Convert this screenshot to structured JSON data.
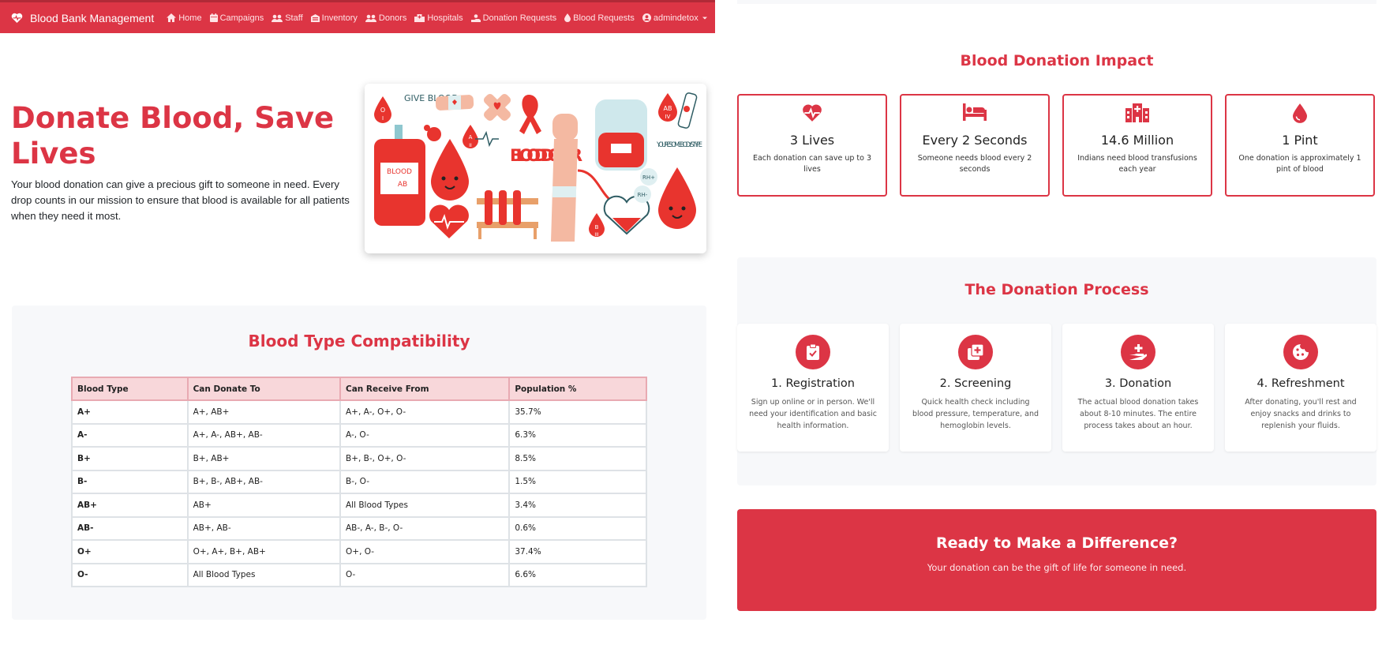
{
  "brand": {
    "name": "Blood Bank Management",
    "icon": "heart-pulse-icon"
  },
  "nav": {
    "items": [
      {
        "label": "Home",
        "icon": "home-icon"
      },
      {
        "label": "Campaigns",
        "icon": "calendar-icon"
      },
      {
        "label": "Staff",
        "icon": "users-icon"
      },
      {
        "label": "Inventory",
        "icon": "warehouse-icon"
      },
      {
        "label": "Donors",
        "icon": "users-icon"
      },
      {
        "label": "Hospitals",
        "icon": "hospital-icon"
      },
      {
        "label": "Donation Requests",
        "icon": "hand-icon"
      },
      {
        "label": "Blood Requests",
        "icon": "droplet-icon"
      }
    ],
    "user": {
      "label": "admindetox",
      "icon": "user-circle-icon"
    }
  },
  "hero": {
    "title": "Donate Blood, Save Lives",
    "text": "Your blood donation can give a precious gift to someone in need. Every drop counts in our mission to ensure that blood is available for all patients when they need it most.",
    "image_texts": {
      "give_blood": "GIVE BLOOD",
      "blood_donor": "BLOOD DONOR",
      "bag_label_1": "BLOOD",
      "bag_label_2": "AB",
      "somebody": "YOU'RE SOMEBODY'S TYPE",
      "o": "O",
      "o_num": "I",
      "a": "A",
      "a_num": "II",
      "ab": "AB",
      "ab_num": "IV",
      "b": "B",
      "b_num": "III",
      "rh_plus": "RH+",
      "rh_minus": "RH-"
    }
  },
  "compatibility": {
    "title": "Blood Type Compatibility",
    "headers": [
      "Blood Type",
      "Can Donate To",
      "Can Receive From",
      "Population %"
    ],
    "rows": [
      [
        "A+",
        "A+, AB+",
        "A+, A-, O+, O-",
        "35.7%"
      ],
      [
        "A-",
        "A+, A-, AB+, AB-",
        "A-, O-",
        "6.3%"
      ],
      [
        "B+",
        "B+, AB+",
        "B+, B-, O+, O-",
        "8.5%"
      ],
      [
        "B-",
        "B+, B-, AB+, AB-",
        "B-, O-",
        "1.5%"
      ],
      [
        "AB+",
        "AB+",
        "All Blood Types",
        "3.4%"
      ],
      [
        "AB-",
        "AB+, AB-",
        "AB-, A-, B-, O-",
        "0.6%"
      ],
      [
        "O+",
        "O+, A+, B+, AB+",
        "O+, O-",
        "37.4%"
      ],
      [
        "O-",
        "All Blood Types",
        "O-",
        "6.6%"
      ]
    ]
  },
  "impact": {
    "title": "Blood Donation Impact",
    "cards": [
      {
        "icon": "heart-pulse-icon",
        "stat": "3 Lives",
        "desc": "Each donation can save up to 3 lives"
      },
      {
        "icon": "bed-icon",
        "stat": "Every 2 Seconds",
        "desc": "Someone needs blood every 2 seconds"
      },
      {
        "icon": "hospital-icon",
        "stat": "14.6 Million",
        "desc": "Indians need blood transfusions each year"
      },
      {
        "icon": "droplet-icon",
        "stat": "1 Pint",
        "desc": "One donation is approximately 1 pint of blood"
      }
    ]
  },
  "process": {
    "title": "The Donation Process",
    "steps": [
      {
        "icon": "clipboard-check-icon",
        "title": "1. Registration",
        "desc": "Sign up online or in person. We'll need your identification and basic health information."
      },
      {
        "icon": "medical-box-icon",
        "title": "2. Screening",
        "desc": "Quick health check including blood pressure, temperature, and hemoglobin levels."
      },
      {
        "icon": "hand-holding-medical-icon",
        "title": "3. Donation",
        "desc": "The actual blood donation takes about 8-10 minutes. The entire process takes about an hour."
      },
      {
        "icon": "cookie-icon",
        "title": "4. Refreshment",
        "desc": "After donating, you'll rest and enjoy snacks and drinks to replenish your fluids."
      }
    ]
  },
  "cta": {
    "title": "Ready to Make a Difference?",
    "text": "Your donation can be the gift of life for someone in need."
  },
  "colors": {
    "primary": "#dc3545",
    "panel": "#f7f8fa",
    "table_header": "#f8d7da"
  }
}
